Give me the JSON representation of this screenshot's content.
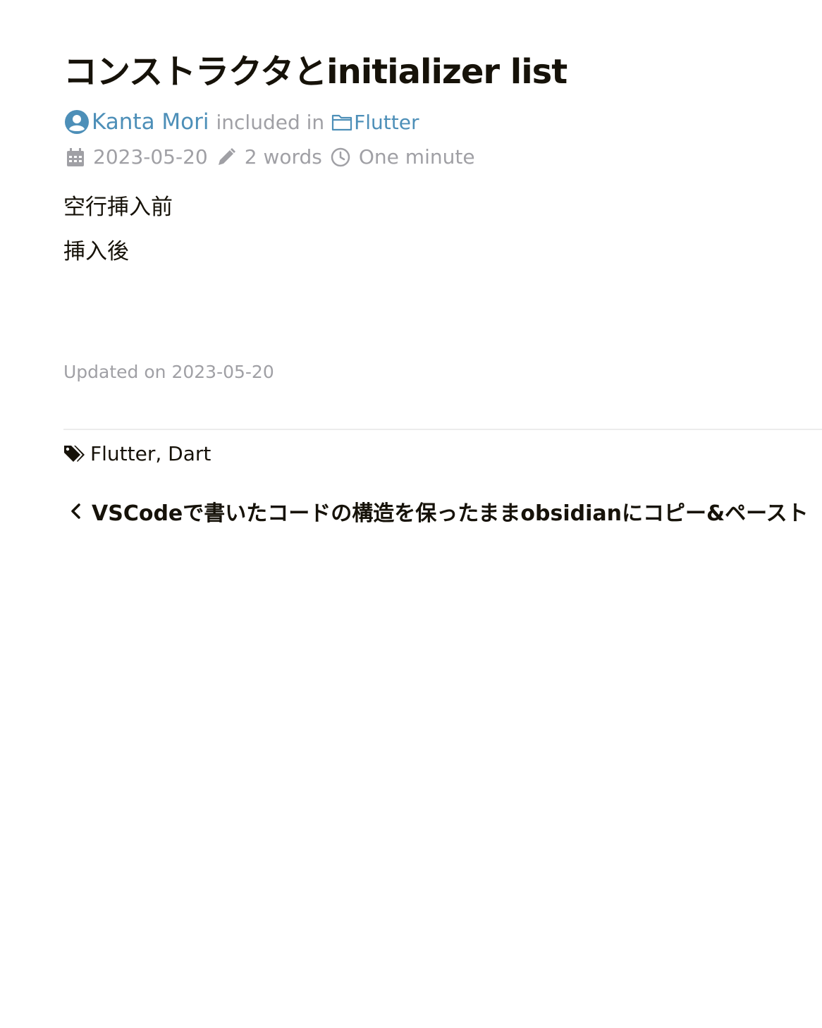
{
  "post": {
    "title": "コンストラクタとinitializer list",
    "author": "Kanta Mori",
    "included_in": "included in",
    "category": "Flutter",
    "date": "2023-05-20",
    "word_count": "2 words",
    "reading_time": "One minute",
    "paragraphs": [
      "空行挿入前",
      "挿入後"
    ],
    "updated": "Updated on 2023-05-20"
  },
  "footer": {
    "tags": [
      "Flutter",
      "Dart"
    ],
    "tag_separator": ", ",
    "prev_post_label": "VSCodeで書いたコードの構造を保ったままobsidianにコピー&ペースト"
  },
  "icons": {
    "author": "user-circle-icon",
    "category": "folder-icon",
    "date": "calendar-icon",
    "words": "pencil-icon",
    "reading_time": "clock-icon",
    "tags": "tags-icon",
    "prev": "chevron-left-icon"
  },
  "colors": {
    "link": "#4d8fb8",
    "muted": "#a0a0a5",
    "text": "#161209",
    "divider": "#ececec"
  }
}
